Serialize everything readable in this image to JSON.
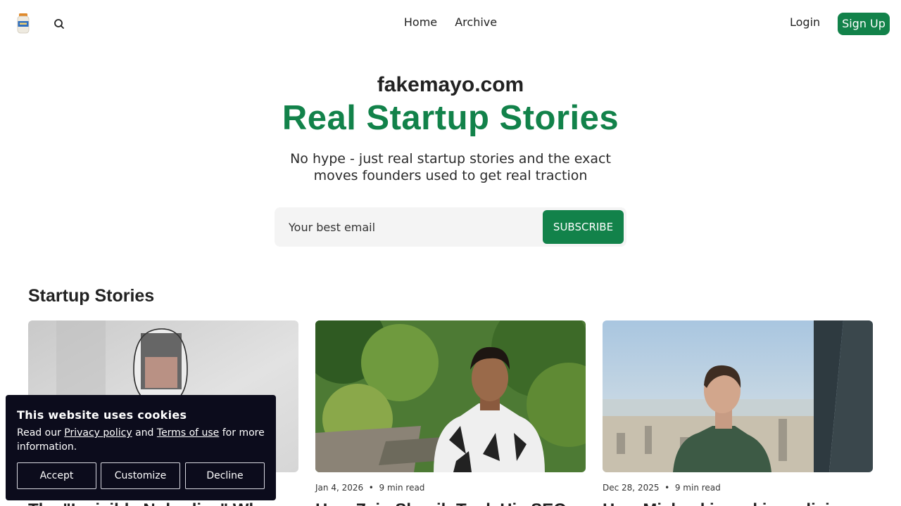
{
  "header": {
    "nav": [
      "Home",
      "Archive"
    ],
    "login_label": "Login",
    "signup_label": "Sign Up"
  },
  "hero": {
    "site_name": "fakemayo.com",
    "headline": "Real Startup Stories",
    "tagline": "No hype - just real startup stories and the exact moves founders used to get real traction",
    "email_placeholder": "Your best email",
    "subscribe_label": "SUBSCRIBE"
  },
  "section": {
    "title": "Startup Stories"
  },
  "cards": [
    {
      "date": "",
      "read_time": "",
      "title": "The \"Invisible Nobodies\" Who"
    },
    {
      "date": "Jan 4, 2026",
      "read_time": "9 min read",
      "title": "How Zain Shoaib Took His SEO"
    },
    {
      "date": "Dec 28, 2025",
      "read_time": "9 min read",
      "title": "How Michael is making a living"
    }
  ],
  "cookie": {
    "title": "This website uses cookies",
    "text_before": "Read our ",
    "privacy_link": "Privacy policy",
    "text_mid": " and ",
    "terms_link": "Terms of use",
    "text_after": " for more information.",
    "accept_label": "Accept",
    "customize_label": "Customize",
    "decline_label": "Decline"
  },
  "colors": {
    "brand_green": "#12824a",
    "cookie_bg": "#0c0c1c"
  },
  "icons": [
    "mayo-jar-logo-icon",
    "search-icon"
  ]
}
